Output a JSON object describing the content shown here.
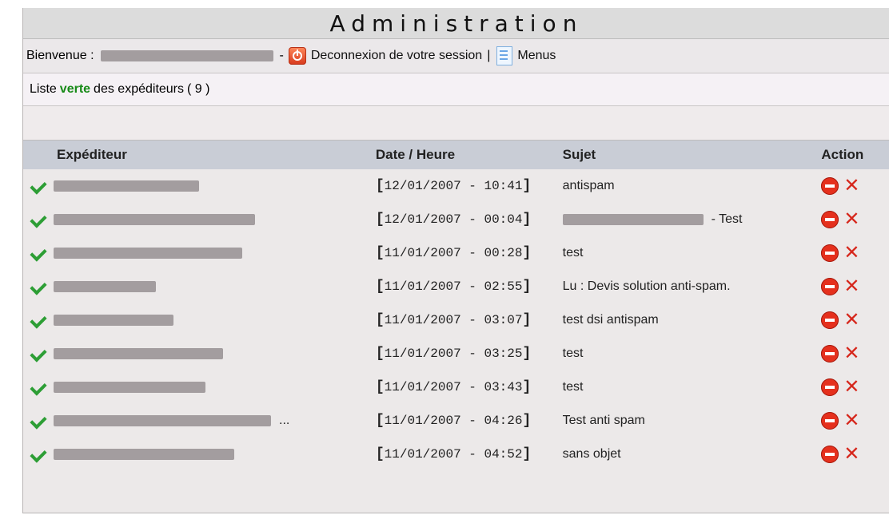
{
  "title": "Administration",
  "header": {
    "welcome_label": "Bienvenue :",
    "dash": "-",
    "logout_label": "Deconnexion de votre session",
    "separator": "|",
    "menus_label": "Menus"
  },
  "list": {
    "prefix": "Liste",
    "highlight": "verte",
    "suffix": "des expéditeurs",
    "count": "( 9 )"
  },
  "table": {
    "columns": [
      "Expéditeur",
      "Date / Heure",
      "Sujet",
      "Action"
    ],
    "rows": [
      {
        "sender": "",
        "date_open": "[",
        "date": "12/01/2007 - 10:41",
        "date_close": "]",
        "subject": "antispam"
      },
      {
        "sender": "",
        "date_open": "[",
        "date": "12/01/2007 - 00:04",
        "date_close": "]",
        "subject": "- Test"
      },
      {
        "sender": "",
        "date_open": "[",
        "date": "11/01/2007 - 00:28",
        "date_close": "]",
        "subject": "test"
      },
      {
        "sender": "",
        "date_open": "[",
        "date": "11/01/2007 - 02:55",
        "date_close": "]",
        "subject": "Lu : Devis solution anti-spam."
      },
      {
        "sender": "",
        "date_open": "[",
        "date": "11/01/2007 - 03:07",
        "date_close": "]",
        "subject": "test dsi antispam"
      },
      {
        "sender": "",
        "date_open": "[",
        "date": "11/01/2007 - 03:25",
        "date_close": "]",
        "subject": "test"
      },
      {
        "sender": "",
        "date_open": "[",
        "date": "11/01/2007 - 03:43",
        "date_close": "]",
        "subject": "test"
      },
      {
        "sender": "...",
        "date_open": "[",
        "date": "11/01/2007 - 04:26",
        "date_close": "]",
        "subject": "Test anti spam"
      },
      {
        "sender": "",
        "date_open": "[",
        "date": "11/01/2007 - 04:52",
        "date_close": "]",
        "subject": "sans objet"
      }
    ]
  },
  "icons": {
    "check": "check-icon",
    "block": "block-icon",
    "delete": "delete-icon",
    "logout": "power-icon",
    "menu": "document-icon"
  },
  "colors": {
    "highlight_green": "#178a17",
    "header_bg": "#c9cdd6",
    "action_red": "#d6271c"
  }
}
